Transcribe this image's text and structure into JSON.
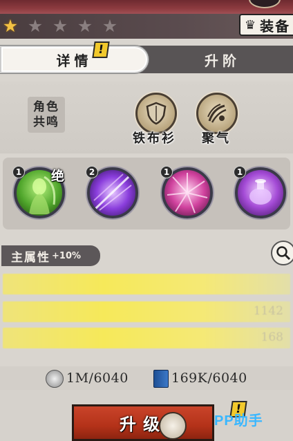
{
  "header": {
    "stars_total": 5,
    "stars_filled": 1,
    "equip_label": "装备"
  },
  "tabs": {
    "detail_label": "详情",
    "upgrade_label": "升阶",
    "alert_mark": "!"
  },
  "resonance": {
    "line1": "角色",
    "line2": "共鸣"
  },
  "skills": [
    {
      "label": "铁布衫",
      "icon": "shield-icon"
    },
    {
      "label": "聚气",
      "icon": "energy-swirl-icon"
    }
  ],
  "orbs": [
    {
      "level": "1",
      "tag": "绝",
      "color": "#5fbf3a",
      "icon": "green-figure-skill-icon"
    },
    {
      "level": "2",
      "tag": "",
      "color": "#8a3ddc",
      "icon": "purple-slash-skill-icon"
    },
    {
      "level": "1",
      "tag": "",
      "color": "#d0429e",
      "icon": "pink-burst-skill-icon"
    },
    {
      "level": "1",
      "tag": "",
      "color": "#a44bd6",
      "icon": "purple-artifact-skill-icon"
    }
  ],
  "attributes": {
    "title": "主属性",
    "bonus": "+10%",
    "rows": [
      {
        "value": ""
      },
      {
        "value": "1142"
      },
      {
        "value": "168"
      }
    ]
  },
  "currency": {
    "silver": "1M/6040",
    "books": "169K/6040"
  },
  "footer": {
    "upgrade_label": "升级",
    "alert_mark": "!",
    "watermark": "PP助手"
  }
}
